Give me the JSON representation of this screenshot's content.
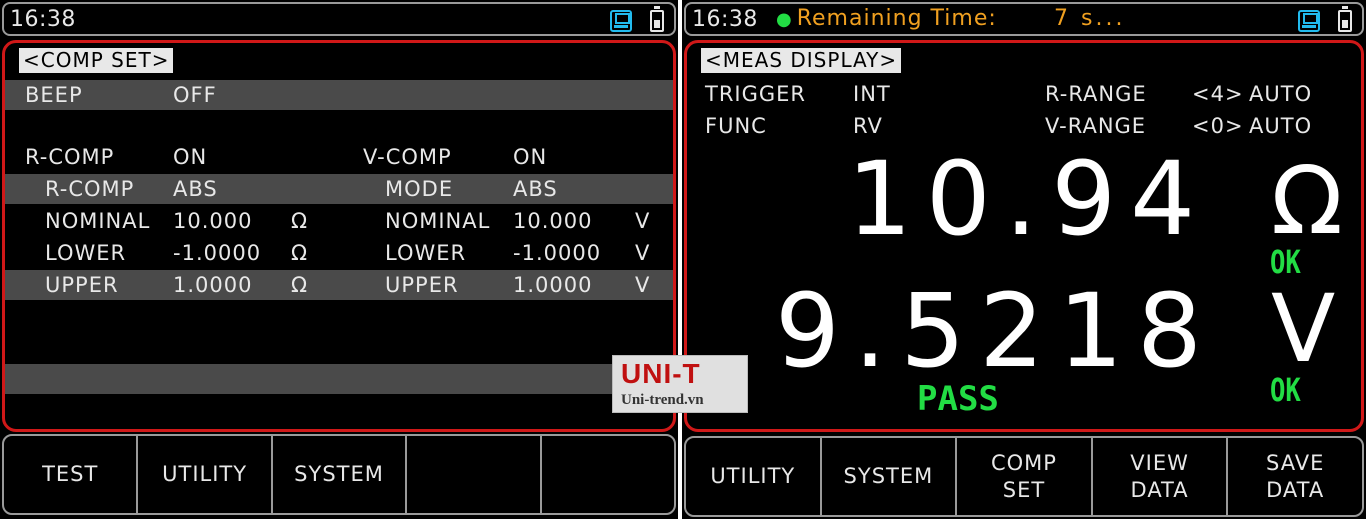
{
  "left": {
    "status": {
      "time": "16:38"
    },
    "title": "<COMP SET>",
    "beep": {
      "label": "BEEP",
      "value": "OFF"
    },
    "r_comp": {
      "label": "R-COMP",
      "state": "ON",
      "mode_label": "R-COMP",
      "mode": "ABS",
      "nominal_label": "NOMINAL",
      "nominal": "10.000",
      "nominal_unit": "Ω",
      "lower_label": "LOWER",
      "lower": "-1.0000",
      "lower_unit": "Ω",
      "upper_label": "UPPER",
      "upper": "1.0000",
      "upper_unit": "Ω"
    },
    "v_comp": {
      "label": "V-COMP",
      "state": "ON",
      "mode_label": "MODE",
      "mode": "ABS",
      "nominal_label": "NOMINAL",
      "nominal": "10.000",
      "nominal_unit": "V",
      "lower_label": "LOWER",
      "lower": "-1.0000",
      "lower_unit": "V",
      "upper_label": "UPPER",
      "upper": "1.0000",
      "upper_unit": "V"
    },
    "softkeys": [
      "TEST",
      "UTILITY",
      "SYSTEM",
      "",
      ""
    ]
  },
  "right": {
    "status": {
      "time": "16:38",
      "remaining_label": "Remaining Time:",
      "remaining_value": "7 s..."
    },
    "title": "<MEAS DISPLAY>",
    "trigger": {
      "label": "TRIGGER",
      "value": "INT"
    },
    "func": {
      "label": "FUNC",
      "value": "RV"
    },
    "r_range": {
      "label": "R-RANGE",
      "index": "<4>",
      "mode": "AUTO"
    },
    "v_range": {
      "label": "V-RANGE",
      "index": "<0>",
      "mode": "AUTO"
    },
    "resistance": {
      "value": "10.94",
      "unit": "Ω",
      "status": "OK"
    },
    "voltage": {
      "value": "9.5218",
      "unit": "V",
      "status": "OK"
    },
    "overall": "PASS",
    "softkeys": [
      "UTILITY",
      "SYSTEM",
      "COMP\nSET",
      "VIEW\nDATA",
      "SAVE\nDATA"
    ]
  },
  "watermark": {
    "brand": "UNI-T",
    "site": "Uni-trend.vn"
  },
  "colors": {
    "panel_border": "#d01818",
    "ok_green": "#22dd44",
    "remaining_orange": "#f0a020",
    "icon_cyan": "#22bbee"
  },
  "icons": [
    "save-disk-icon",
    "battery-icon"
  ]
}
